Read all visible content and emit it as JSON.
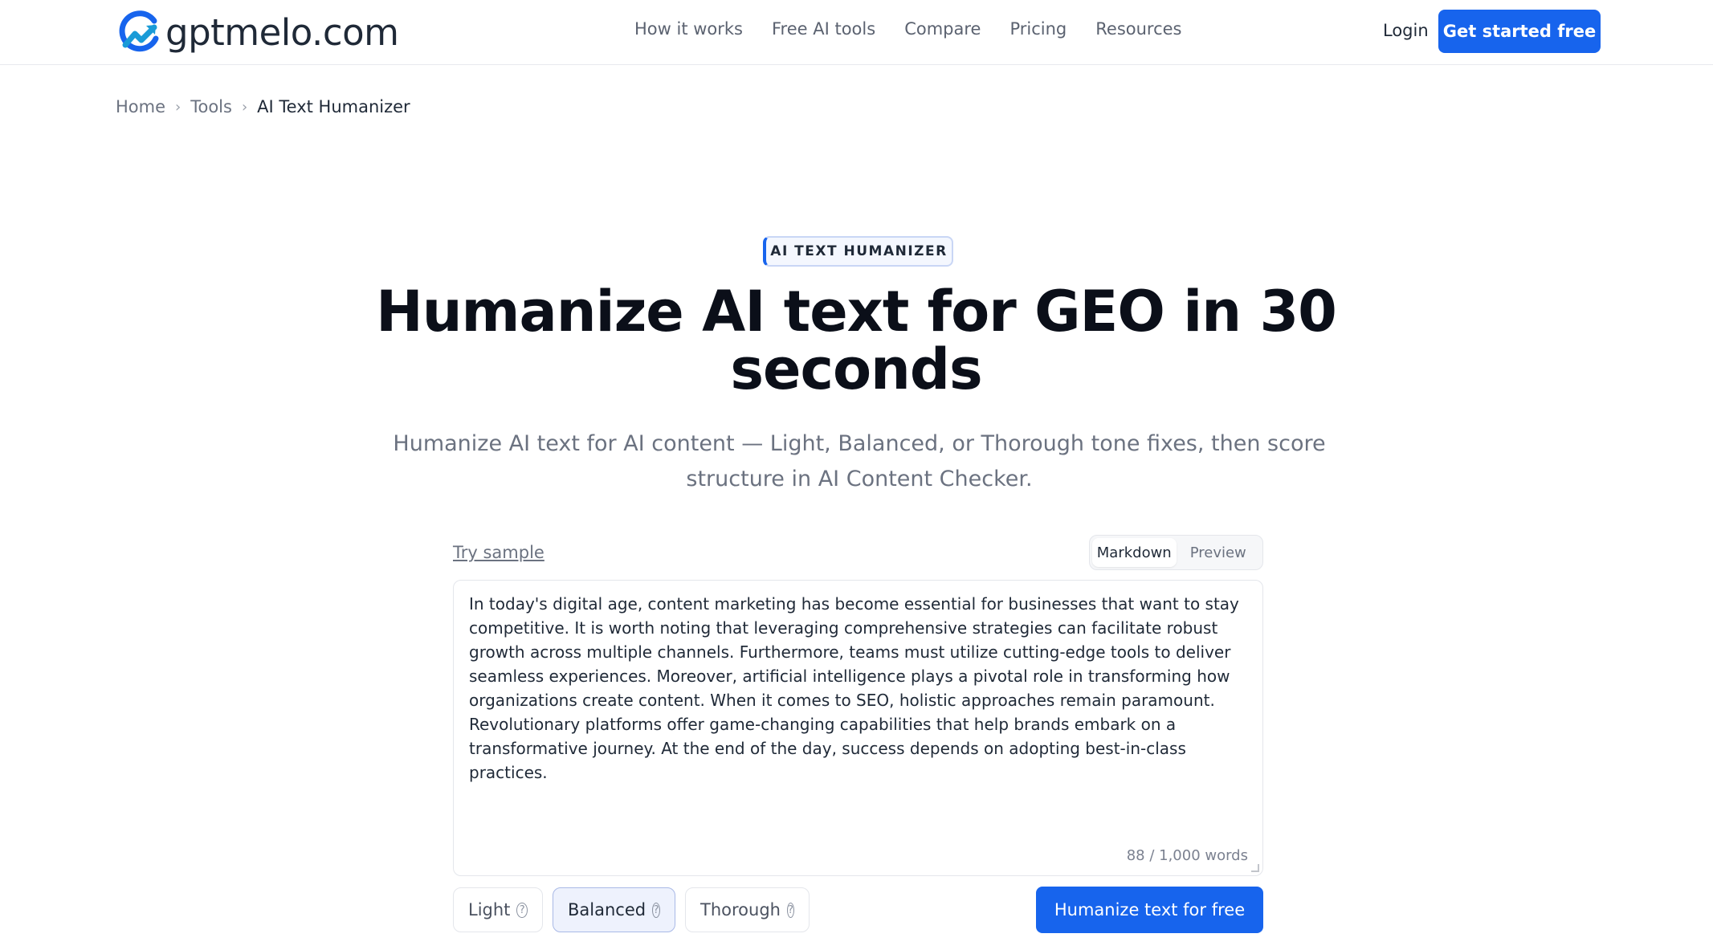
{
  "header": {
    "logo_text": "gptmelo.com",
    "nav": [
      "How it works",
      "Free AI tools",
      "Compare",
      "Pricing",
      "Resources"
    ],
    "login": "Login",
    "cta": "Get started free"
  },
  "breadcrumb": {
    "items": [
      "Home",
      "Tools"
    ],
    "current": "AI Text Humanizer"
  },
  "hero": {
    "badge": "AI TEXT HUMANIZER",
    "title": "Humanize AI text for GEO in 30 seconds",
    "subtitle": "Humanize AI text for AI content — Light, Balanced, or Thorough tone fixes, then score structure in AI Content Checker."
  },
  "editor": {
    "try_sample": "Try sample",
    "view_options": [
      "Markdown",
      "Preview"
    ],
    "active_view": "Markdown",
    "text": "In today's digital age, content marketing has become essential for businesses that want to stay competitive. It is worth noting that leveraging comprehensive strategies can facilitate robust growth across multiple channels. Furthermore, teams must utilize cutting-edge tools to deliver seamless experiences. Moreover, artificial intelligence plays a pivotal role in transforming how organizations create content. When it comes to SEO, holistic approaches remain paramount. Revolutionary platforms offer game-changing capabilities that help brands embark on a transformative journey. At the end of the day, success depends on adopting best-in-class practices.",
    "word_count": "88 / 1,000 words"
  },
  "modes": {
    "options": [
      "Light",
      "Balanced",
      "Thorough"
    ],
    "selected": "Balanced",
    "help_icon": "question-circle-icon"
  },
  "submit": "Humanize text for free",
  "colors": {
    "primary": "#1764ed",
    "logo_dark": "#1f2937",
    "logo_accent": "#1a9bd7"
  }
}
